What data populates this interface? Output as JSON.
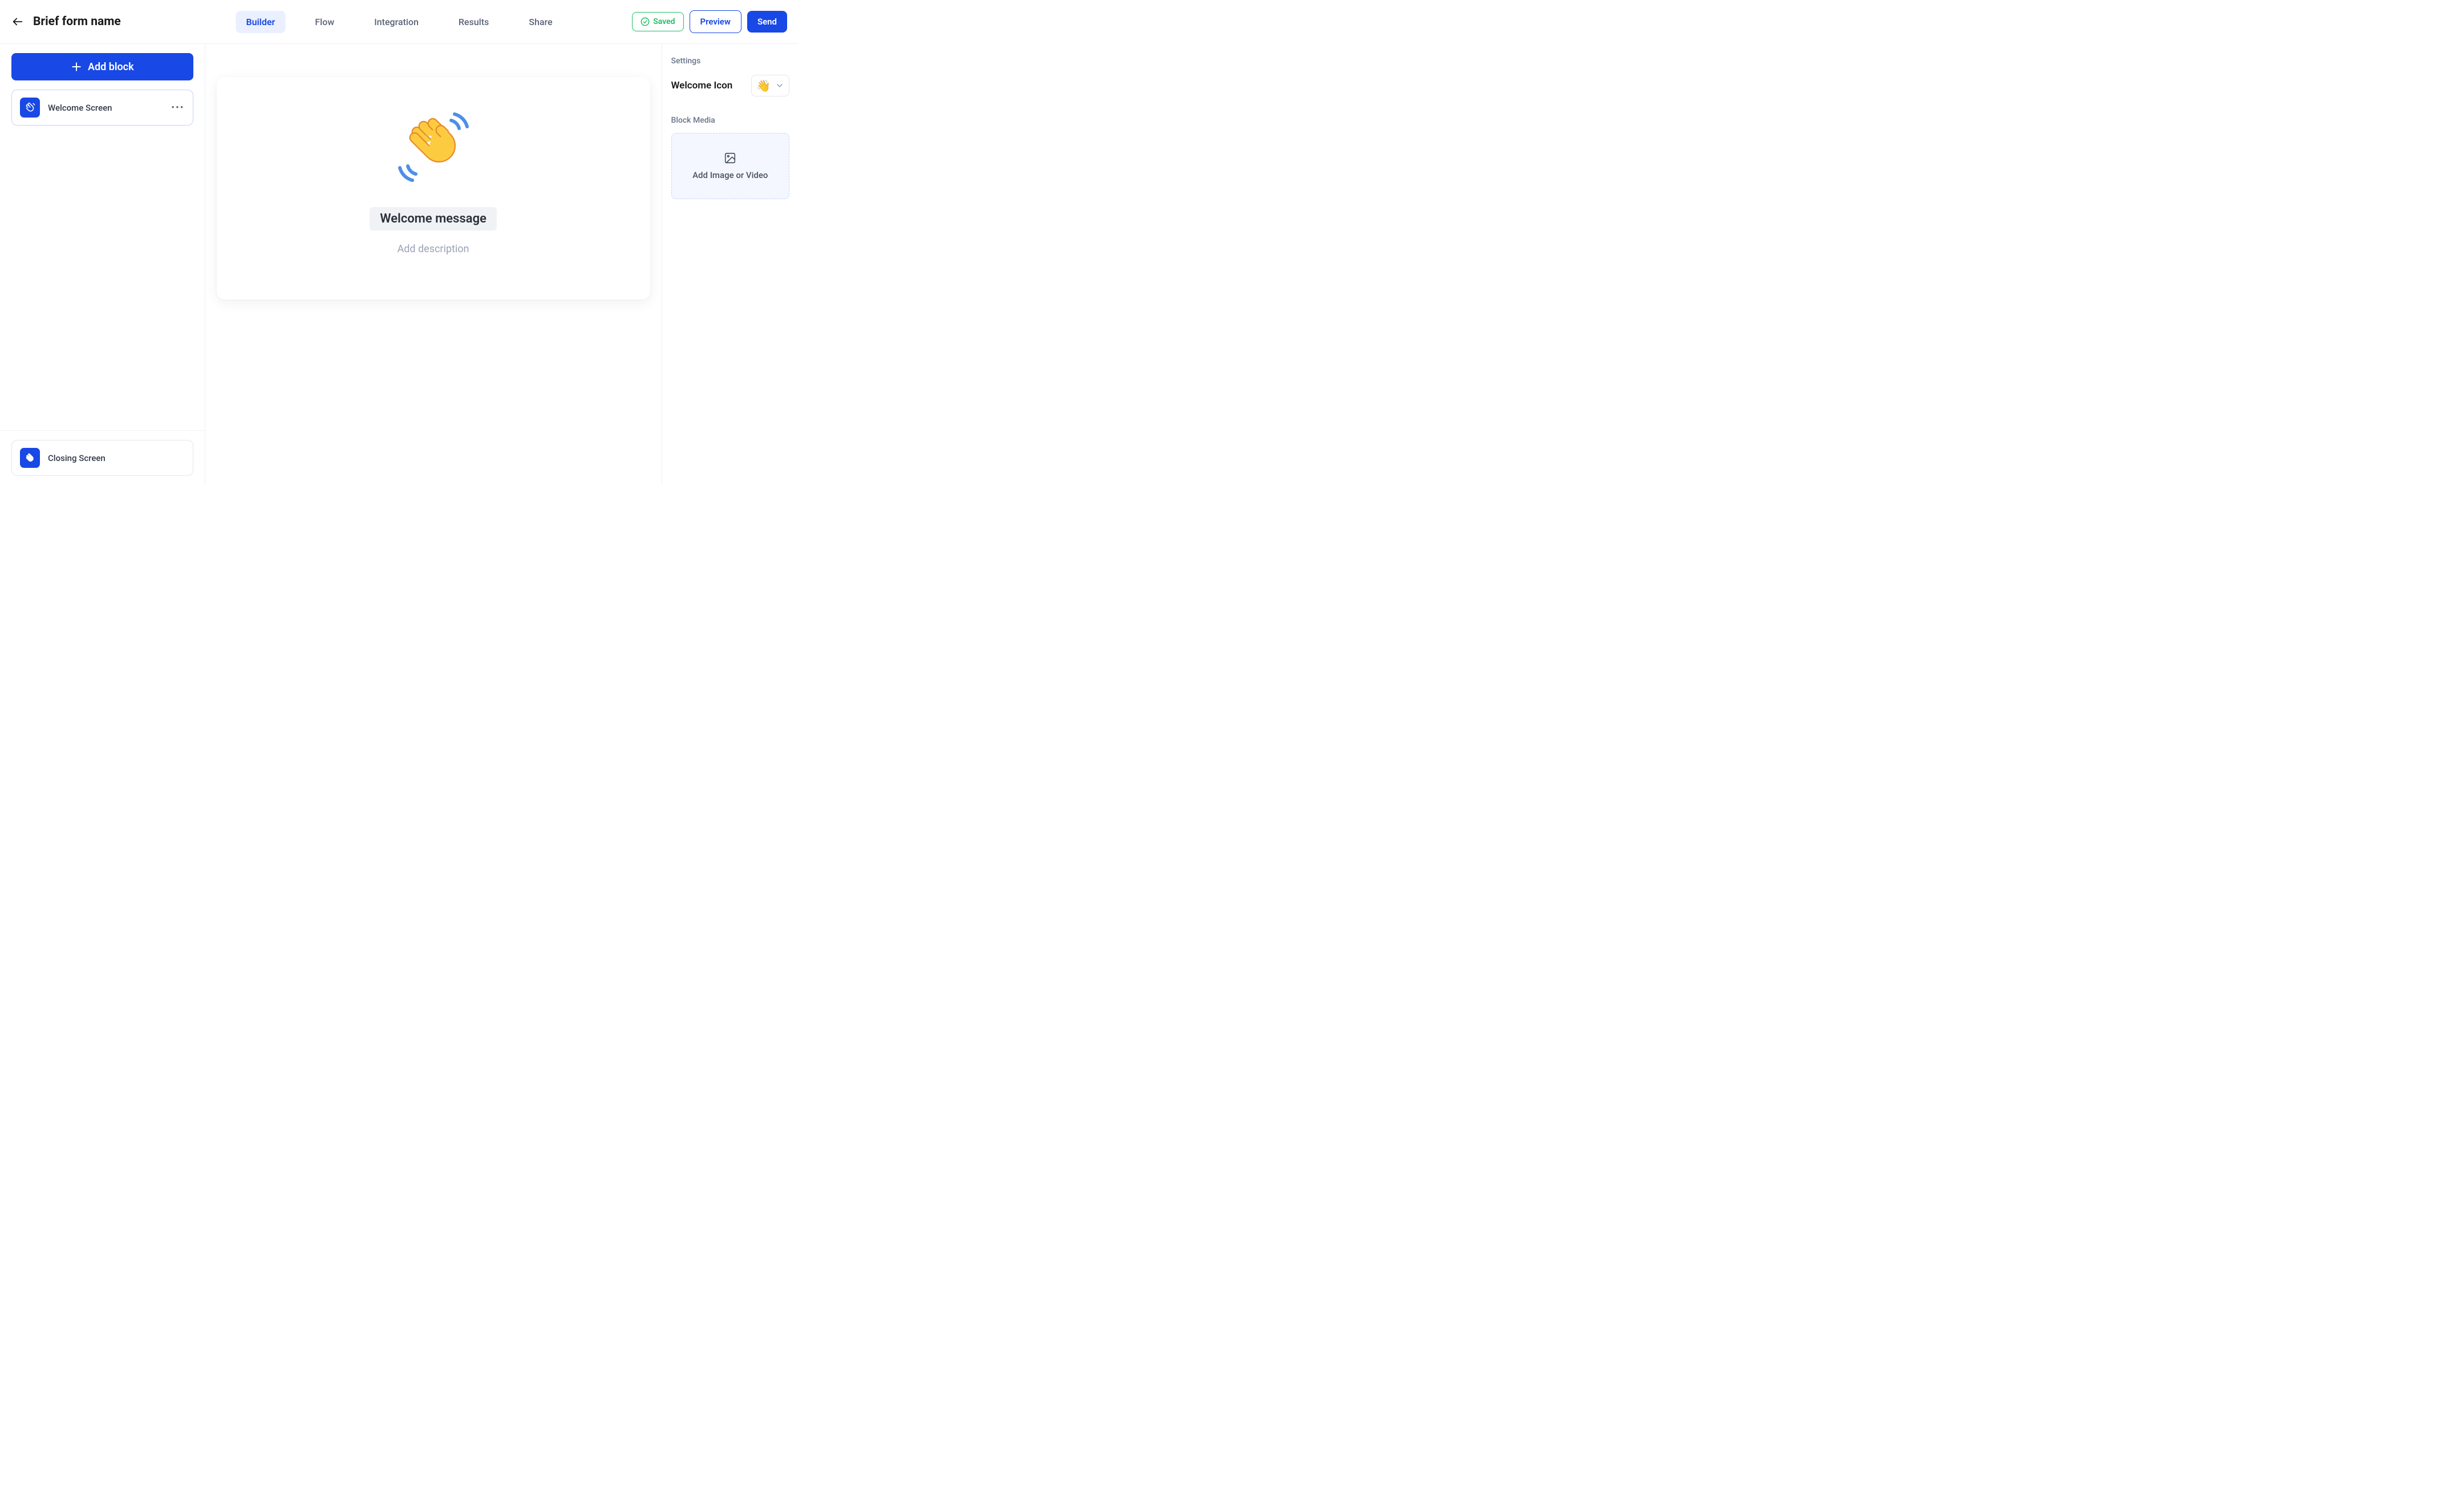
{
  "header": {
    "form_title": "Brief form name",
    "tabs": [
      "Builder",
      "Flow",
      "Integration",
      "Results",
      "Share"
    ],
    "active_tab": 0,
    "saved_label": "Saved",
    "preview_label": "Preview",
    "send_label": "Send"
  },
  "sidebar": {
    "add_block_label": "Add block",
    "blocks": [
      {
        "label": "Welcome Screen",
        "active": true
      }
    ],
    "closing_label": "Closing Screen"
  },
  "canvas": {
    "welcome_message": "Welcome message",
    "description_placeholder": "Add description"
  },
  "settings": {
    "title": "Settings",
    "welcome_icon_label": "Welcome Icon",
    "welcome_icon_value": "wave-hand",
    "block_media_label": "Block Media",
    "media_drop_label": "Add Image or Video"
  },
  "colors": {
    "primary": "#1848e5",
    "success": "#1fbf63"
  }
}
